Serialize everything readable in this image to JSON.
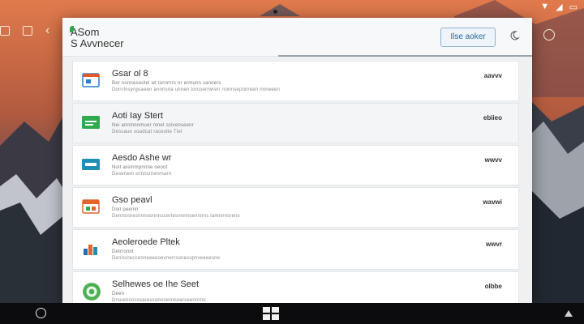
{
  "window": {
    "app_title_line1": "ASom",
    "app_title_line2": "S Avvnecer",
    "action_button": "Ilse aoker"
  },
  "items": [
    {
      "title": "Gsar ol 8",
      "line1": "Ber nonneseotel wt tornrnrs nr ermunn vanners",
      "line2": "Dorrrlnsyrguaeen annnsna unnen torcoerrwrerr nonnsepnnreen nnneeen",
      "meta": "aavvv",
      "icon": "browser-window-icon",
      "accent": "#e05a2a"
    },
    {
      "title": "Aoti Iay Stert",
      "line1": "Nei annmnnmuer mnet sslvenseenr",
      "line2": "Dessaue soadcat raceolte Tlet",
      "meta": "ebiieo",
      "icon": "green-tile-icon",
      "accent": "#2eaa4f"
    },
    {
      "title": "Aesdo Ashe wr",
      "line1": "Noit areinmpnnne oeoot",
      "line2": "Desenem snnncnnmrnarn",
      "meta": "wwvv",
      "icon": "teal-tile-icon",
      "accent": "#1f8fb8"
    },
    {
      "title": "Gso peavl",
      "line1": "Doit peemn",
      "line2": "Dennsnnesnnnoonnnssertesnnnnsennnns lamnnnsrens",
      "meta": "wavwi",
      "icon": "orange-tile-icon",
      "accent": "#e0662e"
    },
    {
      "title": "Aeoleroede Pltek",
      "line1": "Detrronnt",
      "line2": "Dennsneccenneeeeoevnerrsonesspnveeeesne",
      "meta": "wwvr",
      "icon": "bar-chart-icon",
      "accent": "#1f6fb8"
    },
    {
      "title": "Selhewes oe Ihe Seet",
      "line1": "Deen",
      "line2": "Drsuenoosssaressonnrennnnerseenrnnn",
      "meta": "olbbe",
      "icon": "green-circle-icon",
      "accent": "#4caf50"
    }
  ],
  "taskbar": {
    "start_icon": "windows-logo-icon"
  }
}
